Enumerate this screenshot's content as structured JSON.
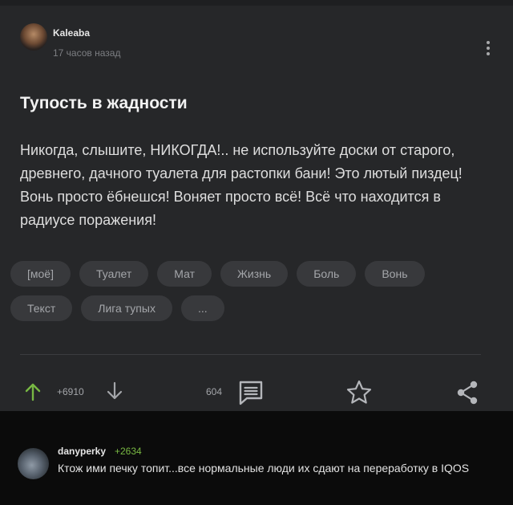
{
  "post": {
    "author": "Kaleaba",
    "time": "17 часов назад",
    "title": "Тупость в жадности",
    "body": "Никогда, слышите, НИКОГДА!.. не используйте доски от старого, древнего, дачного туалета для растопки бани! Это лютый пиздец! Вонь просто ёбнешся! Воняет просто всё! Всё что находится в радиусе поражения!",
    "tags": [
      "[моё]",
      "Туалет",
      "Мат",
      "Жизнь",
      "Боль",
      "Вонь",
      "Текст",
      "Лига тупых",
      "..."
    ],
    "score": "+6910",
    "comments_count": "604"
  },
  "comment": {
    "author": "danyperky",
    "rating": "+2634",
    "text": "Ктож ими печку топит...все нормальные люди их сдают на переработку в IQOS"
  },
  "colors": {
    "post_bg": "#262729",
    "page_bg": "#0b0b0b",
    "upvote": "#78b843",
    "comment_rating": "#79b843",
    "tag_bg": "#38393c"
  },
  "icons": [
    "ellipsis-vertical-icon",
    "arrow-up-icon",
    "arrow-down-icon",
    "comments-icon",
    "star-icon",
    "share-icon"
  ]
}
